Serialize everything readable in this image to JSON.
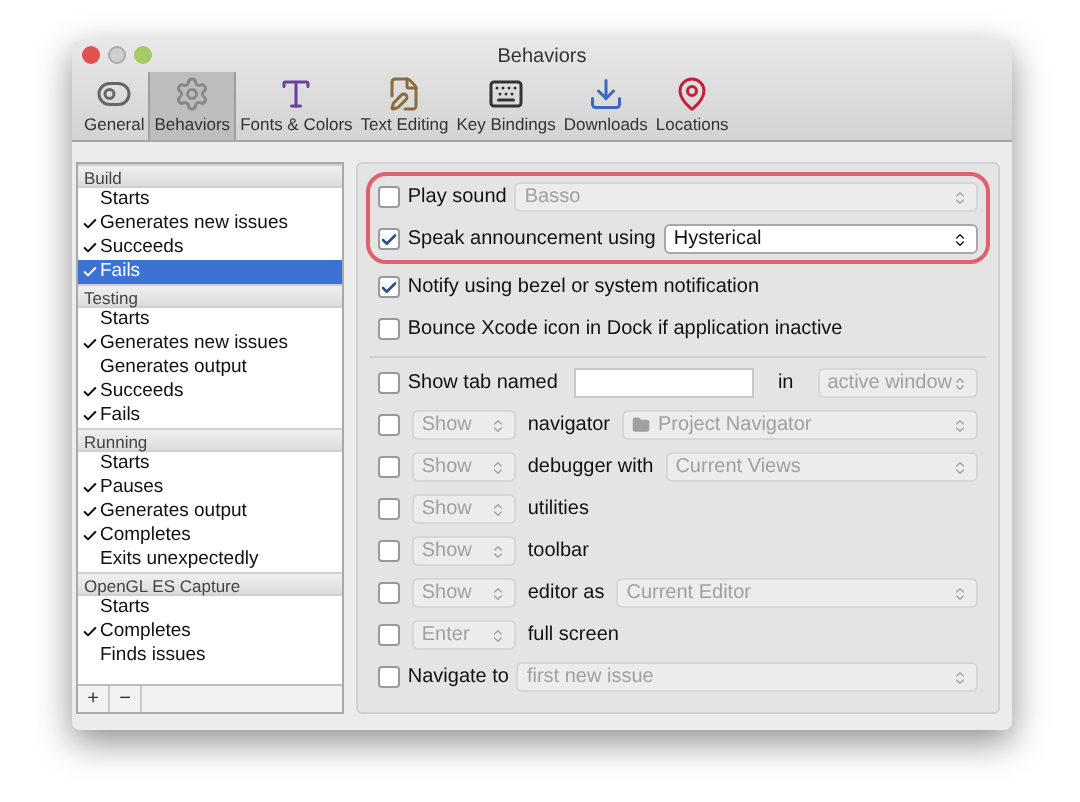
{
  "window": {
    "title": "Behaviors"
  },
  "toolbar": [
    {
      "kind": "general",
      "label": "General",
      "selected": false
    },
    {
      "kind": "behaviors",
      "label": "Behaviors",
      "selected": true
    },
    {
      "kind": "fonts",
      "label": "Fonts & Colors",
      "selected": false
    },
    {
      "kind": "text",
      "label": "Text Editing",
      "selected": false
    },
    {
      "kind": "keys",
      "label": "Key Bindings",
      "selected": false
    },
    {
      "kind": "downloads",
      "label": "Downloads",
      "selected": false
    },
    {
      "kind": "locations",
      "label": "Locations",
      "selected": false
    }
  ],
  "sidebar": {
    "groups": [
      {
        "name": "Build",
        "items": [
          {
            "label": "Starts",
            "checked": false,
            "selected": false
          },
          {
            "label": "Generates new issues",
            "checked": true,
            "selected": false
          },
          {
            "label": "Succeeds",
            "checked": true,
            "selected": false
          },
          {
            "label": "Fails",
            "checked": true,
            "selected": true
          }
        ]
      },
      {
        "name": "Testing",
        "items": [
          {
            "label": "Starts",
            "checked": false,
            "selected": false
          },
          {
            "label": "Generates new issues",
            "checked": true,
            "selected": false
          },
          {
            "label": "Generates output",
            "checked": false,
            "selected": false
          },
          {
            "label": "Succeeds",
            "checked": true,
            "selected": false
          },
          {
            "label": "Fails",
            "checked": true,
            "selected": false
          }
        ]
      },
      {
        "name": "Running",
        "items": [
          {
            "label": "Starts",
            "checked": false,
            "selected": false
          },
          {
            "label": "Pauses",
            "checked": true,
            "selected": false
          },
          {
            "label": "Generates output",
            "checked": true,
            "selected": false
          },
          {
            "label": "Completes",
            "checked": true,
            "selected": false
          },
          {
            "label": "Exits unexpectedly",
            "checked": false,
            "selected": false
          }
        ]
      },
      {
        "name": "OpenGL ES Capture",
        "items": [
          {
            "label": "Starts",
            "checked": false,
            "selected": false
          },
          {
            "label": "Completes",
            "checked": true,
            "selected": false
          },
          {
            "label": "Finds issues",
            "checked": false,
            "selected": false
          }
        ]
      }
    ],
    "buttons": [
      "+",
      "−"
    ]
  },
  "sections": [
    {
      "highlighted": true,
      "rows": [
        {
          "kind": "check_select",
          "checked": false,
          "label": "Play sound",
          "select": {
            "value": "Basso",
            "disabled": true
          }
        },
        {
          "kind": "check_select",
          "checked": true,
          "label": "Speak announcement using",
          "select": {
            "value": "Hysterical",
            "disabled": false
          }
        }
      ]
    },
    {
      "highlighted": false,
      "rows": [
        {
          "kind": "check",
          "checked": true,
          "label": "Notify using bezel or system notification"
        },
        {
          "kind": "check",
          "checked": false,
          "label": "Bounce Xcode icon in Dock if application inactive"
        }
      ]
    },
    {
      "highlighted": false,
      "rows": [
        {
          "kind": "tab",
          "checked": false,
          "label": "Show tab named",
          "joiner": "in",
          "select": {
            "value": "active window",
            "disabled": true
          }
        },
        {
          "kind": "pane",
          "checked": false,
          "action": {
            "value": "Show",
            "disabled": true
          },
          "label": "navigator",
          "select": {
            "value": "Project Navigator",
            "disabled": true,
            "folder": true
          }
        },
        {
          "kind": "pane",
          "checked": false,
          "action": {
            "value": "Show",
            "disabled": true
          },
          "label": "debugger with",
          "select": {
            "value": "Current Views",
            "disabled": true
          }
        },
        {
          "kind": "pane",
          "checked": false,
          "action": {
            "value": "Show",
            "disabled": true
          },
          "label": "utilities"
        },
        {
          "kind": "pane",
          "checked": false,
          "action": {
            "value": "Show",
            "disabled": true
          },
          "label": "toolbar"
        },
        {
          "kind": "pane",
          "checked": false,
          "action": {
            "value": "Show",
            "disabled": true
          },
          "label": "editor as",
          "select": {
            "value": "Current Editor",
            "disabled": true
          }
        },
        {
          "kind": "pane",
          "checked": false,
          "action": {
            "value": "Enter",
            "disabled": true
          },
          "label": "full screen"
        },
        {
          "kind": "check_select",
          "checked": false,
          "label": "Navigate to",
          "select": {
            "value": "first new issue",
            "disabled": true
          }
        }
      ]
    }
  ]
}
